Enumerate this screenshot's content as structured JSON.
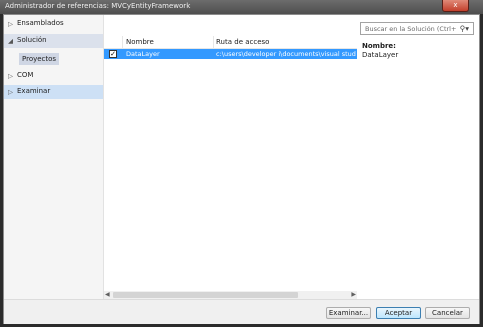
{
  "window": {
    "title": "Administrador de referencias: MVCyEntityFramework",
    "close_label": "x"
  },
  "search": {
    "placeholder": "Buscar en la Solución (Ctrl+E",
    "icon": "search-icon"
  },
  "sidebar": {
    "items": [
      {
        "label": "Ensamblados",
        "arrow": "▷"
      },
      {
        "label": "Solución",
        "arrow": "◢"
      },
      {
        "label": "Proyectos"
      },
      {
        "label": "COM",
        "arrow": "▷"
      },
      {
        "label": "Examinar",
        "arrow": "▷"
      }
    ]
  },
  "list": {
    "columns": [
      "Nombre",
      "Ruta de acceso"
    ],
    "rows": [
      {
        "checked": true,
        "name": "DataLayer",
        "path": "c:\\users\\developer i\\documents\\visual studi"
      }
    ]
  },
  "details": {
    "label": "Nombre:",
    "value": "DataLayer"
  },
  "footer": {
    "browse_label": "Examinar...",
    "accept_label": "Aceptar",
    "cancel_label": "Cancelar"
  },
  "colors": {
    "selection": "#3399ff",
    "sidebar_selected": "#dbe1ec",
    "sidebar_hover": "#cde0f5"
  }
}
